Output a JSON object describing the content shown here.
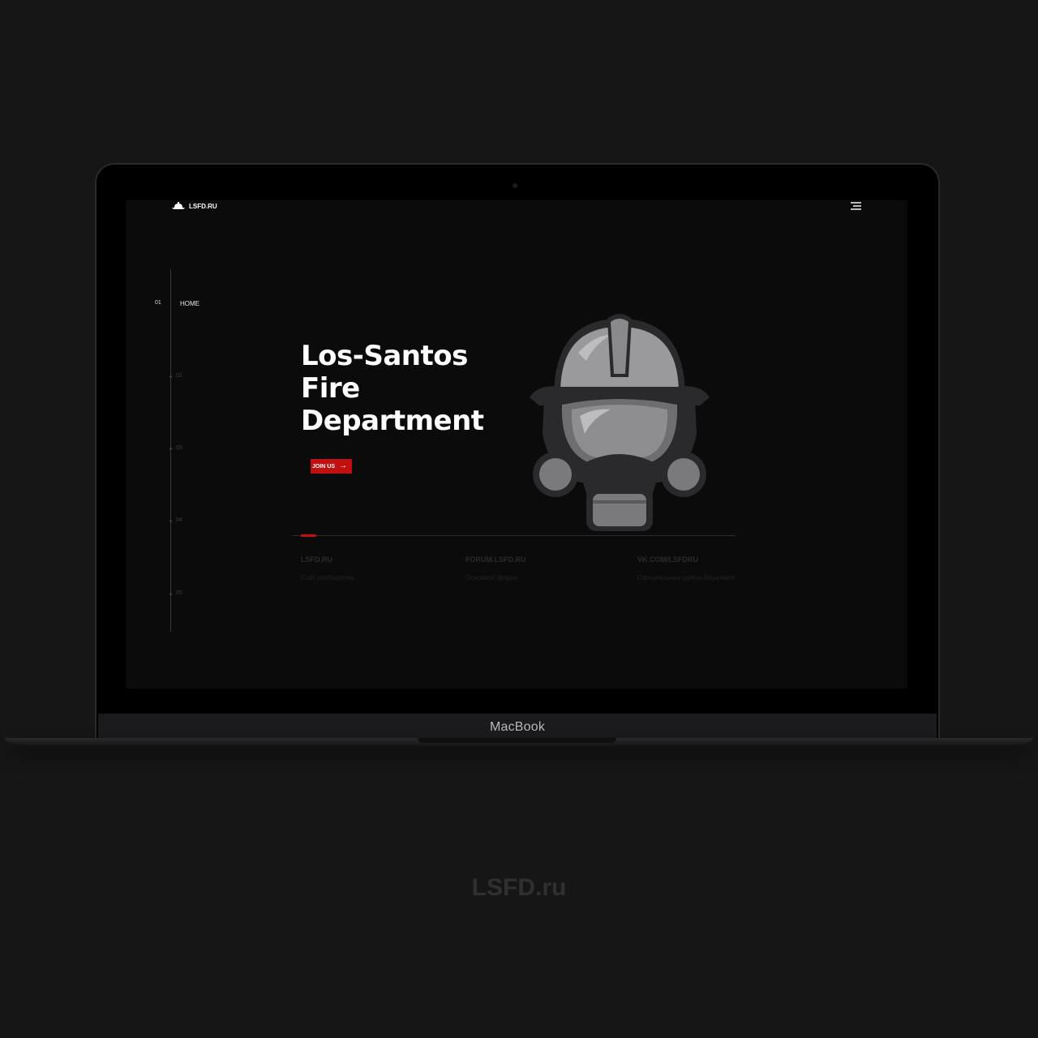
{
  "device": {
    "label": "MacBook"
  },
  "caption": "LSFD.ru",
  "header": {
    "logo_text": "LSFD.RU",
    "menu_icon": "hamburger-icon"
  },
  "nav": {
    "active": {
      "number": "01",
      "label": "HOME"
    },
    "items": [
      {
        "number": "02"
      },
      {
        "number": "03"
      },
      {
        "number": "04"
      },
      {
        "number": "05"
      }
    ]
  },
  "hero": {
    "title_lines": [
      "Los-Santos",
      "Fire",
      "Department"
    ],
    "button_label": "JOIN US",
    "button_icon": "arrow-right-icon",
    "mascot": "firefighter-helmet-gas-mask-icon"
  },
  "progress": {
    "fraction": 0.035
  },
  "links": [
    {
      "title": "LSFD.RU",
      "desc": "Сайт сообщества"
    },
    {
      "title": "FORUM.LSFD.RU",
      "desc": "Основной форум"
    },
    {
      "title": "VK.COM/LSFDRU",
      "desc": "Официальная группа ВКонтакте"
    }
  ],
  "colors": {
    "accent": "#c01010",
    "background": "#0b0b0c",
    "frame": "#161617"
  }
}
